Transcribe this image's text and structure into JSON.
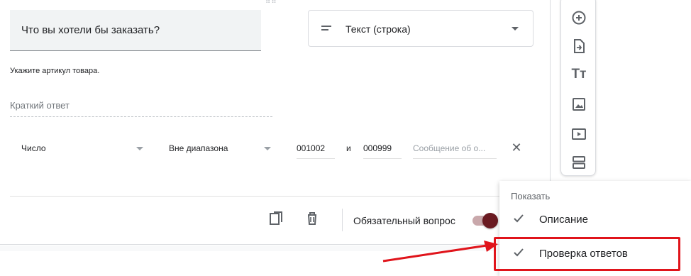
{
  "question": {
    "title": "Что вы хотели бы заказать?",
    "type_label": "Текст (строка)",
    "description": "Укажите артикул товара.",
    "answer_placeholder": "Краткий ответ"
  },
  "validation": {
    "kind": "Число",
    "condition": "Вне диапазона",
    "min": "001002",
    "and_label": "и",
    "max": "000999",
    "error_placeholder": "Сообщение об о..."
  },
  "footer": {
    "required_label": "Обязательный вопрос",
    "required_on": true
  },
  "toolbar": {
    "icons": [
      "add-question-icon",
      "import-questions-icon",
      "title-description-icon",
      "image-icon",
      "video-icon",
      "section-icon"
    ]
  },
  "menu": {
    "header": "Показать",
    "items": [
      {
        "label": "Описание",
        "checked": true
      },
      {
        "label": "Проверка ответов",
        "checked": true
      }
    ]
  },
  "colors": {
    "toggle_on": "#6a1a21",
    "highlight": "#e0141b"
  }
}
